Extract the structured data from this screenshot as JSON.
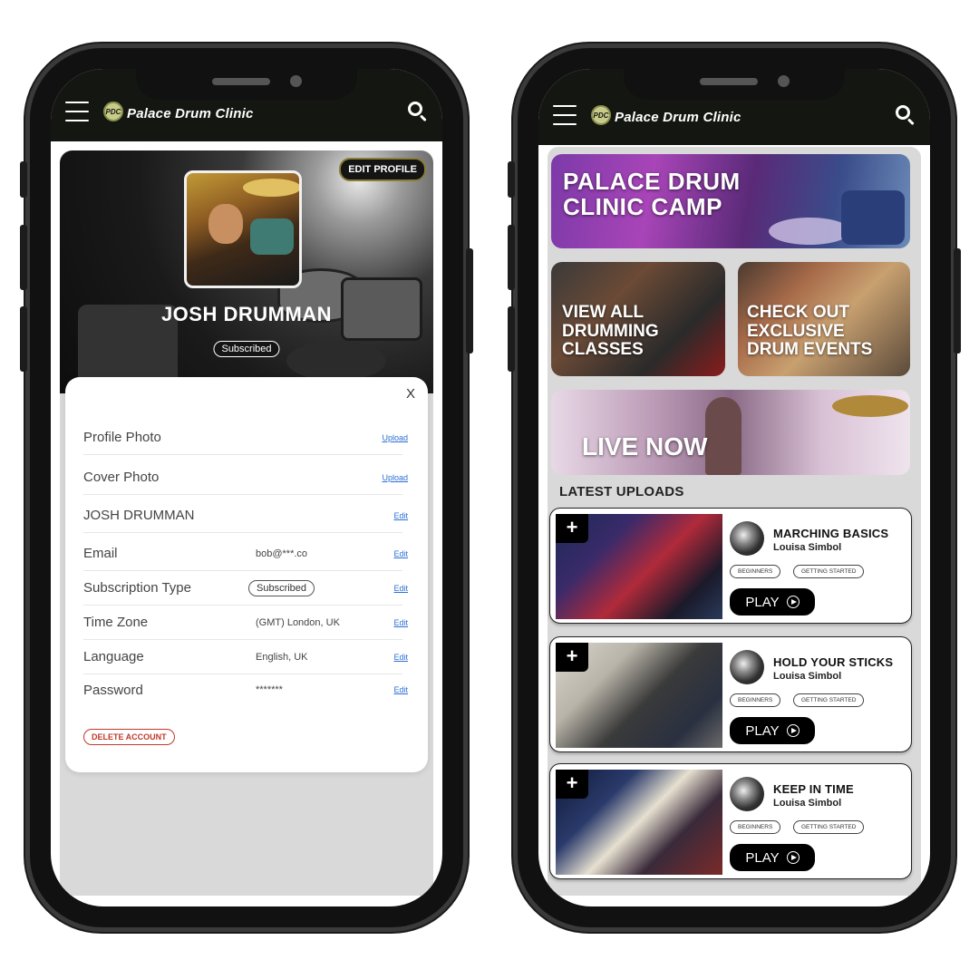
{
  "brand": {
    "name": "Palace Drum Clinic",
    "badge": "PDC"
  },
  "profile": {
    "edit_label": "EDIT PROFILE",
    "name": "JOSH DRUMMAN",
    "status": "Subscribed",
    "close": "X",
    "rows": [
      {
        "label": "Profile Photo",
        "value": "",
        "action": "Upload"
      },
      {
        "label": "Cover Photo",
        "value": "",
        "action": "Upload"
      },
      {
        "label": "JOSH DRUMMAN",
        "value": "",
        "action": "Edit"
      },
      {
        "label": "Email",
        "value": "bob@***.co",
        "action": "Edit"
      },
      {
        "label": "Subscription Type",
        "value": "Subscribed",
        "action": "Edit"
      },
      {
        "label": "Time Zone",
        "value": "(GMT) London, UK",
        "action": "Edit"
      },
      {
        "label": "Language",
        "value": "English, UK",
        "action": "Edit"
      },
      {
        "label": "Password",
        "value": "*******",
        "action": "Edit"
      }
    ],
    "delete_label": "DELETE ACCOUNT"
  },
  "feed": {
    "banners": {
      "camp": "PALACE DRUM\nCLINIC CAMP",
      "classes": "VIEW ALL\nDRUMMING\nCLASSES",
      "events": "CHECK OUT\nEXCLUSIVE\nDRUM EVENTS",
      "live": "LIVE NOW"
    },
    "latest_label": "LATEST UPLOADS",
    "videos": [
      {
        "title": "MARCHING BASICS",
        "author": "Louisa Simbol",
        "tags": [
          "BEGINNERS",
          "GETTING STARTED"
        ],
        "play": "PLAY"
      },
      {
        "title": "HOLD YOUR STICKS",
        "author": "Louisa Simbol",
        "tags": [
          "BEGINNERS",
          "GETTING STARTED"
        ],
        "play": "PLAY"
      },
      {
        "title": "KEEP IN TIME",
        "author": "Louisa Simbol",
        "tags": [
          "BEGINNERS",
          "GETTING STARTED"
        ],
        "play": "PLAY"
      }
    ]
  },
  "icons": {
    "menu": "hamburger-menu-icon",
    "search": "search-icon",
    "add": "plus-icon",
    "play": "play-circle-icon"
  },
  "colors": {
    "appbar": "#141711",
    "link": "#2a6fd6",
    "danger": "#c0392b",
    "panel": "#d9d9d9"
  }
}
